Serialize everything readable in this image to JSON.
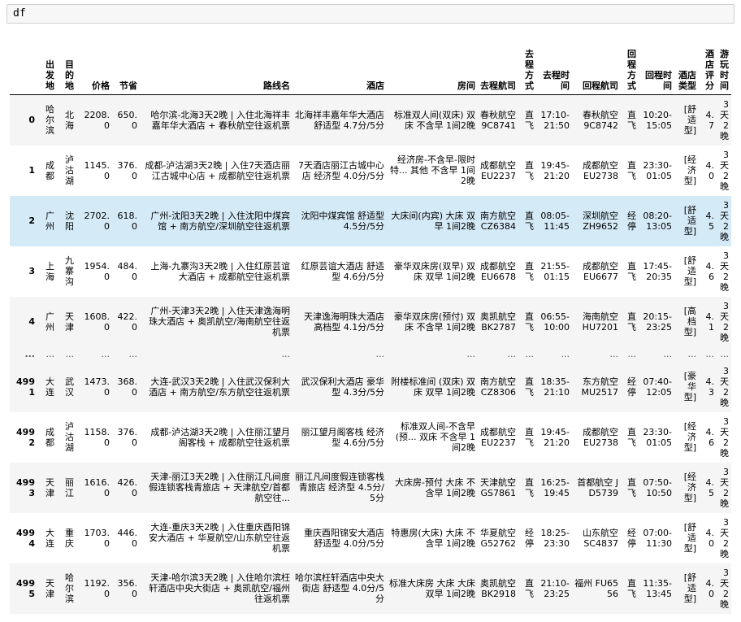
{
  "cell": {
    "code": "df"
  },
  "table": {
    "columns": [
      "出发地",
      "目的地",
      "价格",
      "节省",
      "路线名",
      "酒店",
      "房间",
      "去程航司",
      "去程方式",
      "去程时间",
      "回程航司",
      "回程方式",
      "回程时间",
      "酒店类型",
      "酒店评分",
      "游玩时间"
    ],
    "rows": [
      {
        "index": "0",
        "cells": [
          "哈尔滨",
          "北海",
          "2208.0",
          "650.0",
          "哈尔滨-北海3天2晚 | 入住北海祥丰嘉年华大酒店 + 春秋航空往返机票",
          "北海祥丰嘉年华大酒店 舒适型 4.7分/5分",
          "标准双人间(双床) 双床 不含早 1间2晚",
          "春秋航空 9C8741",
          "直飞",
          "17:10-21:50",
          "春秋航空 9C8742",
          "直飞",
          "10:20-15:05",
          "[舒适型]",
          "4.7",
          "3天2晚"
        ]
      },
      {
        "index": "1",
        "cells": [
          "成都",
          "泸沽湖",
          "1145.0",
          "376.0",
          "成都-泸沽湖3天2晚 | 入住7天酒店丽江古城中心店 + 成都航空往返机票",
          "7天酒店丽江古城中心店 经济型 4.0分/5分",
          "经济房-不含早-限时特... 其他 不含早 1间2晚",
          "成都航空 EU2237",
          "直飞",
          "19:45-21:20",
          "成都航空 EU2738",
          "直飞",
          "23:30-01:05",
          "[经济型]",
          "4.0",
          "3天2晚"
        ]
      },
      {
        "index": "2",
        "cells": [
          "广州",
          "沈阳",
          "2702.0",
          "618.0",
          "广州-沈阳3天2晚 | 入住沈阳中煤宾馆 + 南方航空/深圳航空往返机票",
          "沈阳中煤宾馆 舒适型 4.5分/5分",
          "大床间(内宾) 大床 双早 1间2晚",
          "南方航空 CZ6384",
          "直飞",
          "08:05-11:45",
          "深圳航空 ZH9652",
          "经停",
          "08:20-13:05",
          "[舒适型]",
          "4.5",
          "3天2晚"
        ]
      },
      {
        "index": "3",
        "cells": [
          "上海",
          "九寨沟",
          "1954.0",
          "484.0",
          "上海-九寨沟3天2晚 | 入住红原芸谊大酒店 + 成都航空往返机票",
          "红原芸谊大酒店 舒适型 4.6分/5分",
          "豪华双床房(双早) 双床 双早 1间2晚",
          "成都航空 EU6678",
          "直飞",
          "21:55-01:15",
          "成都航空 EU6677",
          "直飞",
          "17:45-20:35",
          "[舒适型]",
          "4.6",
          "3天2晚"
        ]
      },
      {
        "index": "4",
        "cells": [
          "广州",
          "天津",
          "1608.0",
          "422.0",
          "广州-天津3天2晚 | 入住天津逸海明珠大酒店 + 奥凯航空/海南航空往返机票",
          "天津逸海明珠大酒店 高档型 4.1分/5分",
          "豪华双床房(预付) 双床 不含早 1间2晚",
          "奥凯航空 BK2787",
          "直飞",
          "06:55-10:00",
          "海南航空 HU7201",
          "直飞",
          "20:15-23:25",
          "[高档型]",
          "4.1",
          "3天2晚"
        ]
      },
      {
        "index": "...",
        "ellipsis": true,
        "cells": [
          "...",
          "...",
          "...",
          "...",
          "...",
          "...",
          "...",
          "...",
          "...",
          "...",
          "...",
          "...",
          "...",
          "...",
          "...",
          "..."
        ]
      },
      {
        "index": "4991",
        "cells": [
          "大连",
          "武汉",
          "1473.0",
          "368.0",
          "大连-武汉3天2晚 | 入住武汉保利大酒店 + 南方航空/东方航空往返机票",
          "武汉保利大酒店 豪华型 4.3分/5分",
          "附楼标准间 (双床) 双床 双早 1间2晚",
          "南方航空 CZ8306",
          "直飞",
          "18:35-21:10",
          "东方航空 MU2517",
          "经停",
          "07:40-12:05",
          "[豪华型]",
          "4.3",
          "3天2晚"
        ]
      },
      {
        "index": "4992",
        "cells": [
          "成都",
          "泸沽湖",
          "1158.0",
          "376.0",
          "成都-泸沽湖3天2晚 | 入住丽江望月阁客栈 + 成都航空往返机票",
          "丽江望月阁客栈 经济型 4.6分/5分",
          "标准双人间-不含早(预... 双床 不含早 1间2晚",
          "成都航空 EU2237",
          "直飞",
          "19:45-21:20",
          "成都航空 EU2738",
          "直飞",
          "23:30-01:05",
          "[经济型]",
          "4.6",
          "3天2晚"
        ]
      },
      {
        "index": "4993",
        "cells": [
          "天津",
          "丽江",
          "1616.0",
          "426.0",
          "天津-丽江3天2晚 | 入住丽江凡间度假连锁客栈青旅店 + 天津航空/首都航空往...",
          "丽江凡间度假连锁客栈青旅店 经济型 4.5分/5分",
          "大床房-预付 大床 不含早 1间2晚",
          "天津航空 GS7861",
          "直飞",
          "16:25-19:45",
          "首都航空 JD5739",
          "直飞",
          "07:50-10:50",
          "[经济型]",
          "4.5",
          "3天2晚"
        ]
      },
      {
        "index": "4994",
        "cells": [
          "大连",
          "重庆",
          "1703.0",
          "446.0",
          "大连-重庆3天2晚 | 入住重庆酉阳锦安大酒店 + 华夏航空/山东航空往返机票",
          "重庆酉阳锦安大酒店 舒适型 4.0分/5分",
          "特惠房(大床) 大床 不含早 1间2晚",
          "华夏航空 G52762",
          "经停",
          "18:25-23:30",
          "山东航空 SC4837",
          "经停",
          "07:00-11:30",
          "[舒适型]",
          "4.0",
          "3天2晚"
        ]
      },
      {
        "index": "4995",
        "cells": [
          "天津",
          "哈尔滨",
          "1192.0",
          "356.0",
          "天津-哈尔滨3天2晚 | 入住哈尔滨枉轩酒店中央大街店 + 奥凯航空/福州往返机票",
          "哈尔滨枉轩酒店中央大街店 舒适型 4.0分/5分",
          "标准大床房 大床 大床 双早 1间2晚",
          "奥凯航空 BK2918",
          "直飞",
          "21:10-23:25",
          "福州 FU6556",
          "直飞",
          "11:35-13:45",
          "[舒适型]",
          "4.0",
          "3天2晚"
        ]
      }
    ]
  }
}
